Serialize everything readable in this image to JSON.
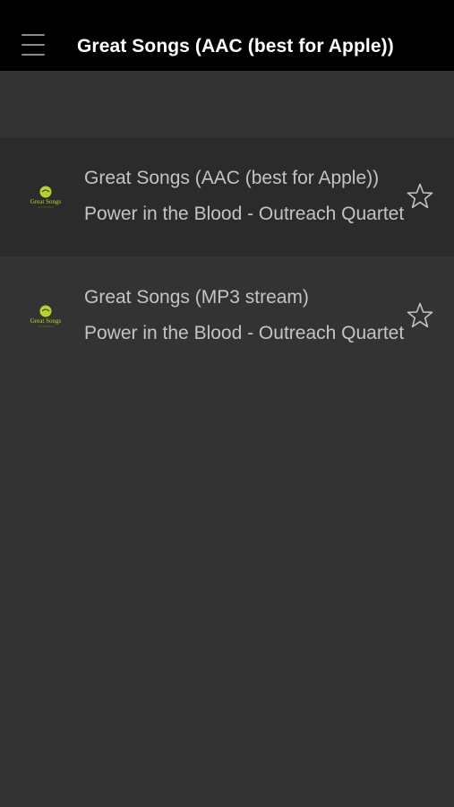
{
  "header": {
    "title": "Great Songs (AAC (best for Apple))",
    "menu_icon": "hamburger-menu-icon"
  },
  "stations": [
    {
      "title": "Great Songs (AAC (best for Apple))",
      "track": "Power in the Blood - Outreach Quartet",
      "logo_text": "Great Songs",
      "favorite_icon": "star-outline-icon",
      "selected": true
    },
    {
      "title": "Great Songs (MP3 stream)",
      "track": "Power in the Blood - Outreach Quartet",
      "logo_text": "Great Songs",
      "favorite_icon": "star-outline-icon",
      "selected": false
    }
  ],
  "colors": {
    "background": "#333333",
    "header_bg": "#000000",
    "selected_row": "#2b2b2b",
    "text": "#c4c4c4",
    "logo_accent": "#b5d22f"
  }
}
